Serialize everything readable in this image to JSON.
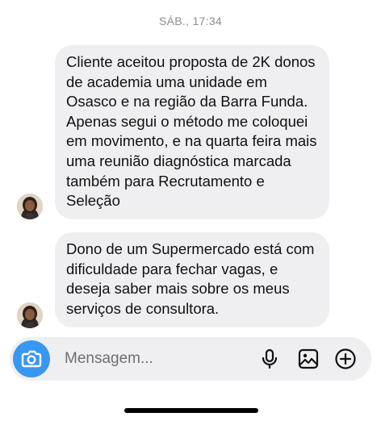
{
  "header": {
    "timestamp": "SÁB., 17:34"
  },
  "messages": [
    {
      "text": "Cliente aceitou proposta de 2K donos de academia uma unidade em Osasco e na região da Barra Funda. Apenas segui o método me coloquei em movimento, e na quarta feira mais uma reunião diagnóstica marcada também para Recrutamento e Seleção"
    },
    {
      "text": "Dono de um Supermercado está com dificuldade para fechar vagas, e deseja saber mais sobre os meus serviços de consultora."
    }
  ],
  "composer": {
    "placeholder": "Mensagem...",
    "value": "",
    "icons": [
      "camera-icon",
      "microphone-icon",
      "gallery-icon",
      "plus-icon"
    ]
  },
  "colors": {
    "bubble": "#efeff1",
    "camera_button": "#3897f0",
    "timestamp": "#8e8e93"
  }
}
